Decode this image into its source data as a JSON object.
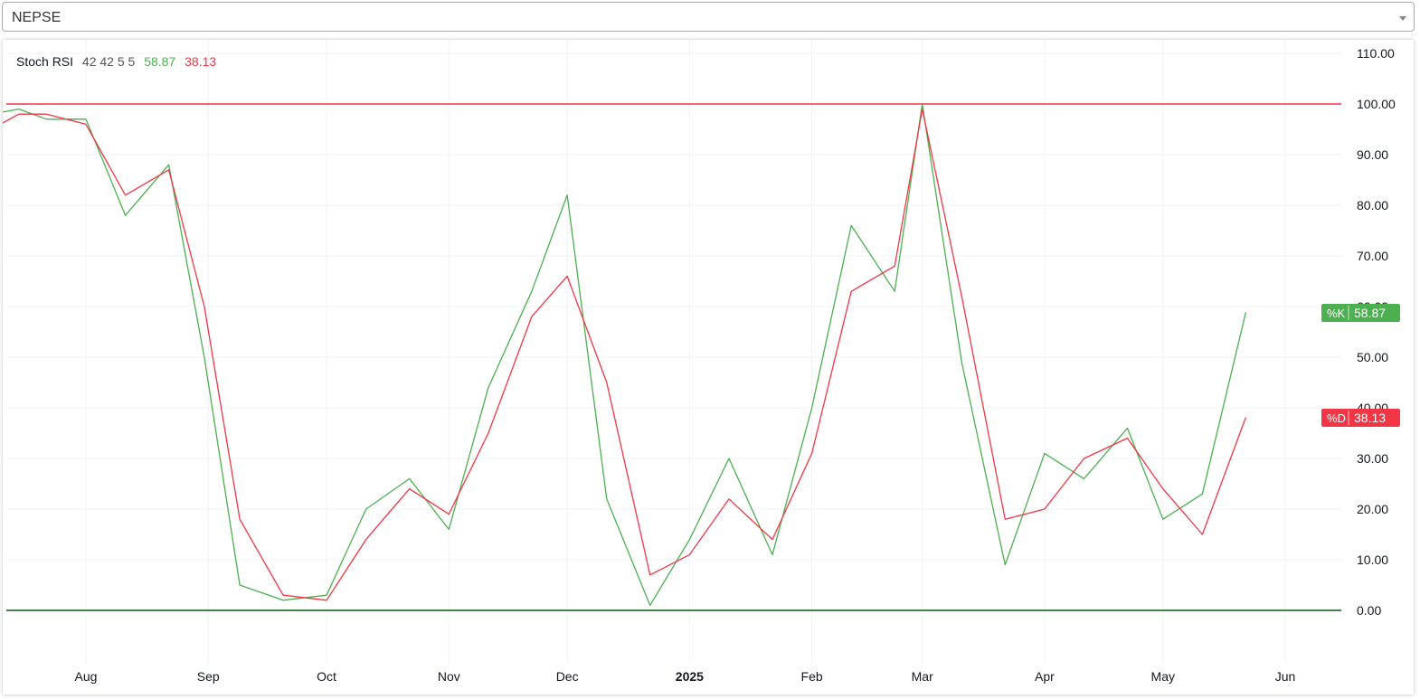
{
  "selector": {
    "value": "NEPSE"
  },
  "legend": {
    "name": "Stoch RSI",
    "params": "42 42 5 5",
    "k_value": "58.87",
    "d_value": "38.13"
  },
  "badges": {
    "k_label": "%K",
    "k_value": "58.87",
    "d_label": "%D",
    "d_value": "38.13"
  },
  "colors": {
    "k": "#4caf50",
    "d": "#f23645",
    "upper_band": "#f23645",
    "lower_band": "#0a5c0a"
  },
  "chart_data": {
    "type": "line",
    "x_axis": [
      "Aug",
      "Sep",
      "Oct",
      "Nov",
      "Dec",
      "2025",
      "Feb",
      "Mar",
      "Apr",
      "May",
      "Jun"
    ],
    "y_axis": [
      "110.00",
      "100.00",
      "90.00",
      "80.00",
      "70.00",
      "60.00",
      "50.00",
      "40.00",
      "30.00",
      "20.00",
      "10.00",
      "0.00"
    ],
    "ylim": [
      0,
      110
    ],
    "bands": [
      100,
      0
    ],
    "x_dates": [
      "2024-07-08",
      "2024-07-15",
      "2024-07-22",
      "2024-08-01",
      "2024-08-11",
      "2024-08-22",
      "2024-08-31",
      "2024-09-09",
      "2024-09-20",
      "2024-10-01",
      "2024-10-11",
      "2024-10-22",
      "2024-11-01",
      "2024-11-11",
      "2024-11-22",
      "2024-12-01",
      "2024-12-11",
      "2024-12-22",
      "2025-01-01",
      "2025-01-11",
      "2025-01-22",
      "2025-02-01",
      "2025-02-11",
      "2025-02-22",
      "2025-03-01",
      "2025-03-11",
      "2025-03-22",
      "2025-04-01",
      "2025-04-11",
      "2025-04-22",
      "2025-05-01",
      "2025-05-11",
      "2025-05-22"
    ],
    "series": [
      {
        "name": "%K",
        "values": [
          98,
          99,
          97,
          97,
          78,
          88,
          50,
          5,
          2,
          3,
          20,
          26,
          16,
          44,
          63,
          82,
          22,
          1,
          14,
          30,
          11,
          40,
          76,
          63,
          100,
          49,
          9,
          31,
          26,
          36,
          18,
          23,
          58.87
        ]
      },
      {
        "name": "%D",
        "values": [
          95,
          98,
          98,
          96,
          82,
          87,
          60,
          18,
          3,
          2,
          14,
          24,
          19,
          35,
          58,
          66,
          45,
          7,
          11,
          22,
          14,
          31,
          63,
          68,
          99,
          62,
          18,
          20,
          30,
          34,
          24,
          15,
          38.13
        ]
      }
    ]
  }
}
